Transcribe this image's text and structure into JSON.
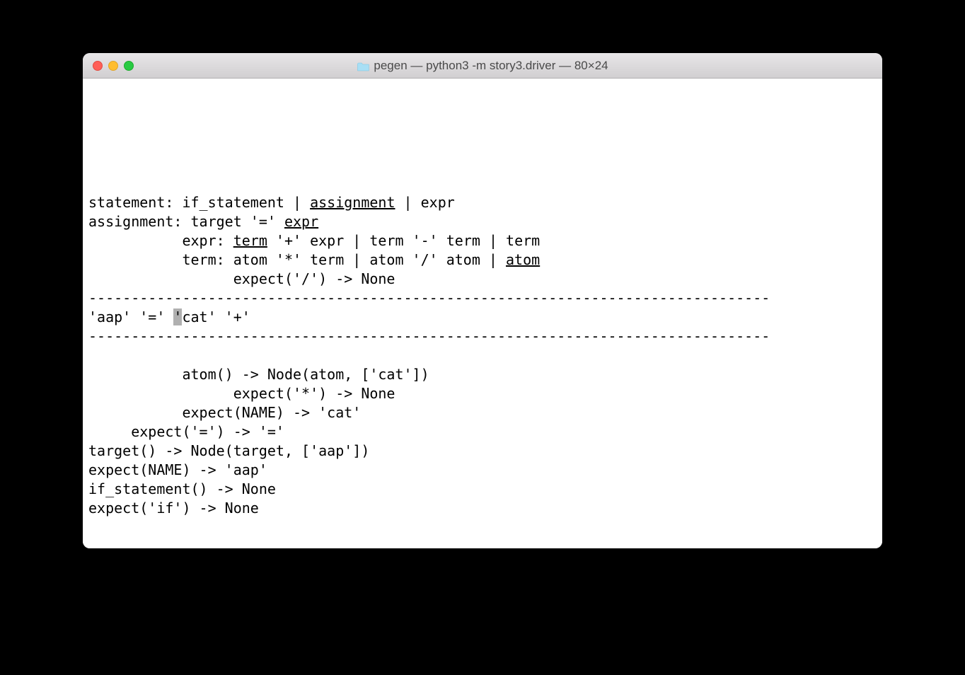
{
  "window": {
    "title": "pegen — python3 -m story3.driver — 80×24"
  },
  "terminal": {
    "lines": {
      "blank1": "",
      "blank2": "",
      "blank3": "",
      "blank4": "",
      "blank5": "",
      "blank6": "",
      "grammar1_pre": "statement: if_statement | ",
      "grammar1_ul": "assignment",
      "grammar1_post": " | expr",
      "grammar2_pre": "assignment: target '=' ",
      "grammar2_ul": "expr",
      "grammar3_pre": "           expr: ",
      "grammar3_ul": "term",
      "grammar3_post": " '+' expr | term '-' term | term",
      "grammar4_pre": "           term: atom '*' term | atom '/' atom | ",
      "grammar4_ul": "atom",
      "expect_div": "                 expect('/') -> None",
      "divider1": "--------------------------------------------------------------------------------",
      "tokens_pre": "'aap' '=' ",
      "tokens_cursor": "'",
      "tokens_post": "cat' '+'",
      "divider2": "--------------------------------------------------------------------------------",
      "blank7": "",
      "trace1": "           atom() -> Node(atom, ['cat'])",
      "trace2": "                 expect('*') -> None",
      "trace3": "           expect(NAME) -> 'cat'",
      "trace4": "     expect('=') -> '='",
      "trace5": "target() -> Node(target, ['aap'])",
      "trace6": "expect(NAME) -> 'aap'",
      "trace7": "if_statement() -> None",
      "trace8": "expect('if') -> None"
    }
  }
}
